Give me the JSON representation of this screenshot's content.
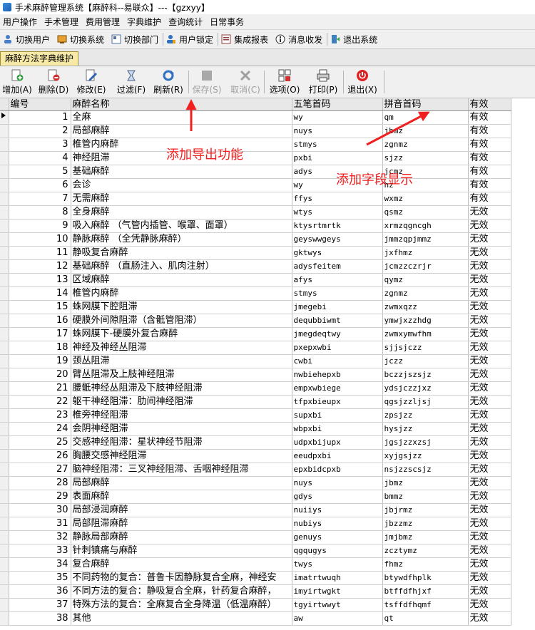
{
  "window": {
    "title": "手术麻醉管理系统【麻醉科--易联众】---【gzxyy】"
  },
  "menu": [
    "用户操作",
    "手术管理",
    "费用管理",
    "字典维护",
    "查询统计",
    "日常事务"
  ],
  "toolbar1": [
    "切换用户",
    "切换系统",
    "切换部门",
    "用户锁定",
    "集成报表",
    "消息收发",
    "退出系统"
  ],
  "tab": {
    "label": "麻醉方法字典维护"
  },
  "toolbar2": [
    {
      "label": "增加(A)",
      "icon": "add-icon",
      "enabled": true
    },
    {
      "label": "删除(D)",
      "icon": "delete-icon",
      "enabled": true
    },
    {
      "label": "修改(E)",
      "icon": "edit-icon",
      "enabled": true
    },
    {
      "label": "过滤(F)",
      "icon": "filter-icon",
      "enabled": true
    },
    {
      "label": "刷新(R)",
      "icon": "refresh-icon",
      "enabled": true
    },
    {
      "label": "保存(S)",
      "icon": "save-icon",
      "enabled": false
    },
    {
      "label": "取消(C)",
      "icon": "cancel-icon",
      "enabled": false
    },
    {
      "label": "选项(O)",
      "icon": "options-icon",
      "enabled": true
    },
    {
      "label": "打印(P)",
      "icon": "print-icon",
      "enabled": true
    },
    {
      "label": "退出(X)",
      "icon": "exit-icon",
      "enabled": true
    }
  ],
  "table": {
    "columns": [
      "编号",
      "麻醉名称",
      "五笔首码",
      "拼音首码",
      "有效"
    ],
    "rows": [
      [
        "1",
        "全麻",
        "wy",
        "qm",
        "有效"
      ],
      [
        "2",
        "局部麻醉",
        "nuys",
        "jbmz",
        "有效"
      ],
      [
        "3",
        "椎管内麻醉",
        "stmys",
        "zgnmz",
        "有效"
      ],
      [
        "4",
        "神经阻滞",
        "pxbi",
        "sjzz",
        "有效"
      ],
      [
        "5",
        "基础麻醉",
        "adys",
        "jcmz",
        "有效"
      ],
      [
        "6",
        "会诊",
        "wy",
        "hz",
        "有效"
      ],
      [
        "7",
        "无需麻醉",
        "ffys",
        "wxmz",
        "有效"
      ],
      [
        "8",
        "全身麻醉",
        "wtys",
        "qsmz",
        "无效"
      ],
      [
        "9",
        "吸入麻醉 （气管内插管、喉罩、面罩）",
        "ktysrtmrtk",
        "xrmzqgncgh",
        "无效"
      ],
      [
        "10",
        "静脉麻醉 （全凭静脉麻醉）",
        "geyswwgeys",
        "jmmzqpjmmz",
        "无效"
      ],
      [
        "11",
        "静吸复合麻醉",
        "gktwys",
        "jxfhmz",
        "无效"
      ],
      [
        "12",
        "基础麻醉 （直肠注入、肌肉注射）",
        "adysfeitem",
        "jcmzzczrjr",
        "无效"
      ],
      [
        "13",
        "区域麻醉",
        "afys",
        "qymz",
        "无效"
      ],
      [
        "14",
        "椎管内麻醉",
        "stmys",
        "zgnmz",
        "无效"
      ],
      [
        "15",
        "蛛网膜下腔阻滞",
        "jmegebi",
        "zwmxqzz",
        "无效"
      ],
      [
        "16",
        "硬膜外间隙阻滞（含骶管阻滞）",
        "dequbbiwmt",
        "ymwjxzzhdg",
        "无效"
      ],
      [
        "17",
        "蛛网膜下-硬膜外复合麻醉",
        "jmegdeqtwy",
        "zwmxymwfhm",
        "无效"
      ],
      [
        "18",
        "神经及神经丛阻滞",
        "pxepxwbi",
        "sjjsjczz",
        "无效"
      ],
      [
        "19",
        "颈丛阻滞",
        "cwbi",
        "jczz",
        "无效"
      ],
      [
        "20",
        "臂丛阻滞及上肢神经阻滞",
        "nwbiehepxb",
        "bczzjszsjz",
        "无效"
      ],
      [
        "21",
        "腰骶神经丛阻滞及下肢神经阻滞",
        "empxwbiege",
        "ydsjczzjxz",
        "无效"
      ],
      [
        "22",
        "躯干神经阻滞：肋间神经阻滞",
        "tfpxbieupx",
        "qgsjzzljsj",
        "无效"
      ],
      [
        "23",
        "椎旁神经阻滞",
        "supxbi",
        "zpsjzz",
        "无效"
      ],
      [
        "24",
        "会阴神经阻滞",
        "wbpxbi",
        "hysjzz",
        "无效"
      ],
      [
        "25",
        "交感神经阻滞：星状神经节阻滞",
        "udpxbijupx",
        "jgsjzzxzsj",
        "无效"
      ],
      [
        "26",
        "胸腰交感神经阻滞",
        "eeudpxbi",
        "xyjgsjzz",
        "无效"
      ],
      [
        "27",
        "脑神经阻滞：三叉神经阻滞、舌咽神经阻滞",
        "epxbidcpxb",
        "nsjzzscsjz",
        "无效"
      ],
      [
        "28",
        "局部麻醉",
        "nuys",
        "jbmz",
        "无效"
      ],
      [
        "29",
        "表面麻醉",
        "gdys",
        "bmmz",
        "无效"
      ],
      [
        "30",
        "局部浸润麻醉",
        "nuiiys",
        "jbjrmz",
        "无效"
      ],
      [
        "31",
        "局部阻滞麻醉",
        "nubiys",
        "jbzzmz",
        "无效"
      ],
      [
        "32",
        "静脉局部麻醉",
        "genuys",
        "jmjbmz",
        "无效"
      ],
      [
        "33",
        "针刺镇痛与麻醉",
        "qgqugys",
        "zcztymz",
        "无效"
      ],
      [
        "34",
        "复合麻醉",
        "twys",
        "fhmz",
        "无效"
      ],
      [
        "35",
        "不同药物的复合：普鲁卡因静脉复合全麻，神经安",
        "imatrtwuqh",
        "btywdfhplk",
        "无效"
      ],
      [
        "36",
        "不同方法的复合：静吸复合全麻，针药复合麻醉，",
        "imyirtwgkt",
        "btffdfhjxf",
        "无效"
      ],
      [
        "37",
        "特殊方法的复合：全麻复合全身降温（低温麻醉）",
        "tgyirtwwyt",
        "tsffdfhqmf",
        "无效"
      ],
      [
        "38",
        "其他",
        "aw",
        "qt",
        "无效"
      ]
    ]
  },
  "annotations": {
    "export": "添加导出功能",
    "field": "添加字段显示"
  },
  "colors": {
    "annotation": "#f02020",
    "tab_bg": "#f7e9a6"
  }
}
